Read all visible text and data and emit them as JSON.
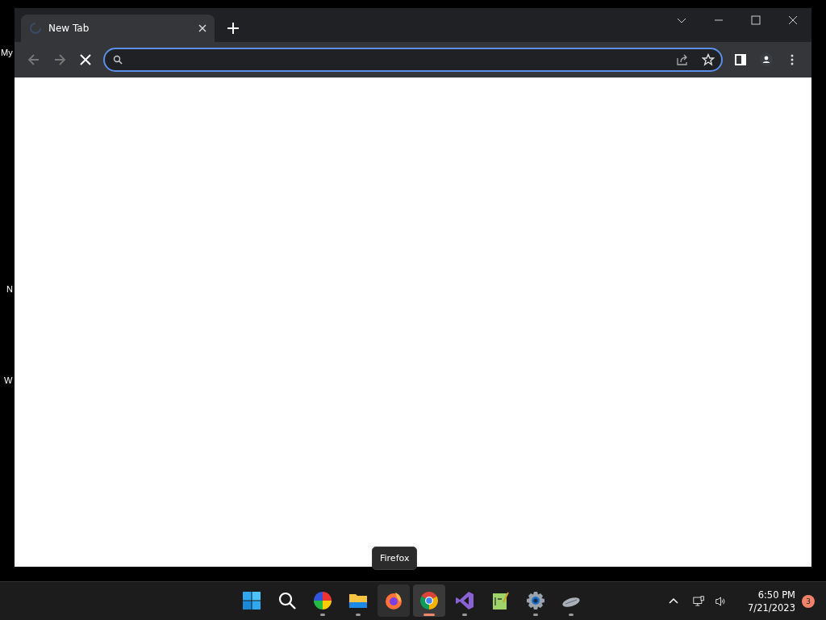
{
  "desktop_icons": [
    {
      "label": "My"
    },
    {
      "label": "N"
    },
    {
      "label": "W"
    }
  ],
  "browser": {
    "tabs": [
      {
        "title": "New Tab",
        "selected": true,
        "loading": true
      }
    ],
    "loading": true,
    "address_bar": {
      "focused": true
    }
  },
  "tooltip": "Firefox",
  "taskbar": {
    "apps": [
      {
        "kind": "start",
        "running": false,
        "selected": false,
        "hovered": false
      },
      {
        "kind": "search",
        "running": false,
        "selected": false,
        "hovered": false
      },
      {
        "kind": "colorwheel",
        "running": true,
        "selected": false,
        "hovered": false
      },
      {
        "kind": "folder",
        "running": true,
        "selected": false,
        "hovered": false
      },
      {
        "kind": "firefox",
        "running": false,
        "selected": false,
        "hovered": true
      },
      {
        "kind": "chrome",
        "running": true,
        "selected": true,
        "hovered": false
      },
      {
        "kind": "vs",
        "running": true,
        "selected": false,
        "hovered": false
      },
      {
        "kind": "notepad",
        "running": false,
        "selected": false,
        "hovered": false
      },
      {
        "kind": "gear",
        "running": true,
        "selected": false,
        "hovered": false
      },
      {
        "kind": "mouse",
        "running": true,
        "selected": false,
        "hovered": false
      }
    ],
    "time": "6:50 PM",
    "date": "7/21/2023",
    "notification_count": "3"
  }
}
